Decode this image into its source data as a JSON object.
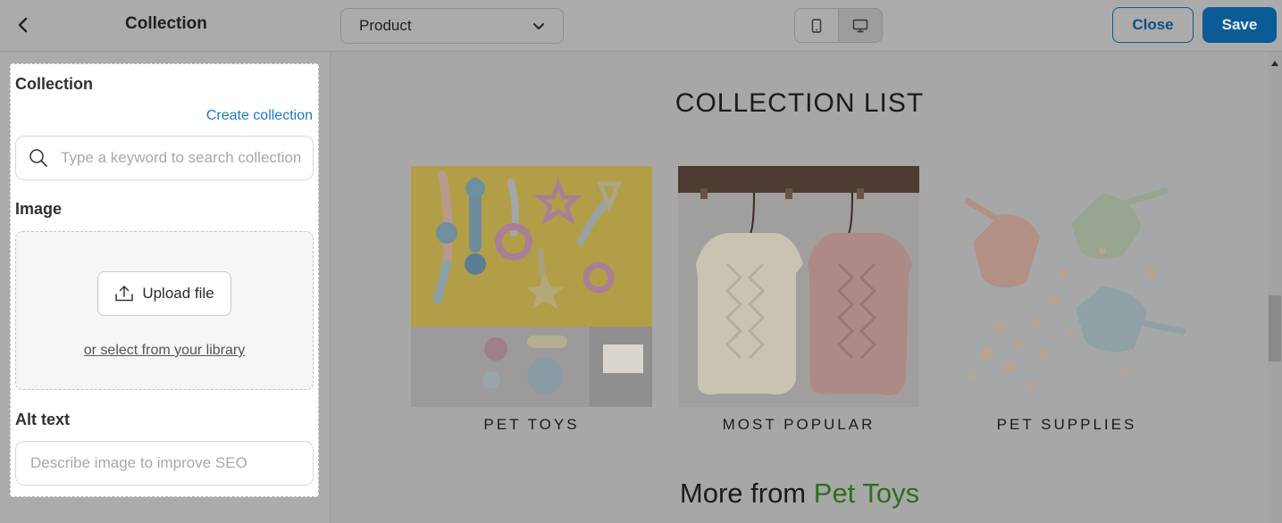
{
  "header": {
    "back_icon": "chevron-left-icon",
    "title": "Collection",
    "template_select": {
      "value": "Product"
    },
    "device_toggle": {
      "options": [
        "mobile",
        "desktop"
      ],
      "selected": "desktop"
    },
    "close_label": "Close",
    "save_label": "Save"
  },
  "panel": {
    "collection_heading": "Collection",
    "create_collection_link": "Create collection",
    "search_placeholder": "Type a keyword to search collections",
    "image_heading": "Image",
    "upload_label": "Upload file",
    "library_link": "or select from your library",
    "alt_heading": "Alt text",
    "alt_placeholder": "Describe image to improve SEO"
  },
  "preview": {
    "heading": "COLLECTION LIST",
    "collections": [
      {
        "label": "PET TOYS"
      },
      {
        "label": "MOST POPULAR"
      },
      {
        "label": "PET SUPPLIES"
      }
    ],
    "more_from_prefix": "More from",
    "more_from_collection": "Pet Toys"
  },
  "colors": {
    "overlay": "#a3a3a3",
    "accent_blue": "#0b5b97",
    "link_blue": "#1a7bc6",
    "accent_green": "#2d6e1c"
  }
}
